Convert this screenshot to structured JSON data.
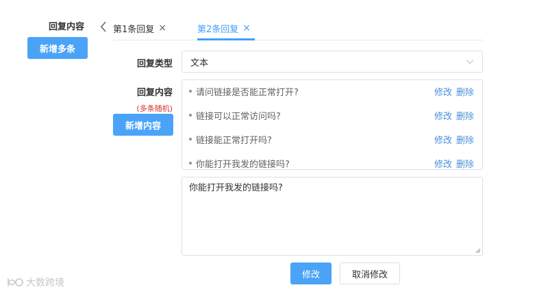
{
  "left_panel": {
    "section_label": "回复内容",
    "add_multi_button": "新增多条"
  },
  "tabs": {
    "items": [
      {
        "label": "第1条回复",
        "active": false
      },
      {
        "label": "第2条回复",
        "active": true
      }
    ]
  },
  "form": {
    "type_label": "回复类型",
    "type_value": "文本",
    "content_label": "回复内容",
    "content_note": "(多条随机)",
    "add_content_button": "新增内容",
    "items": [
      {
        "text": "请问链接是否能正常打开?",
        "edit": "修改",
        "delete": "删除"
      },
      {
        "text": "链接可以正常访问吗?",
        "edit": "修改",
        "delete": "删除"
      },
      {
        "text": "链接能正常打开吗?",
        "edit": "修改",
        "delete": "删除"
      },
      {
        "text": "你能打开我发的链接吗?",
        "edit": "修改",
        "delete": "删除"
      }
    ],
    "editor_value": "你能打开我发的链接吗?",
    "save_button": "修改",
    "cancel_button": "取消修改"
  },
  "watermark": {
    "text": "大数跨境"
  },
  "colors": {
    "primary": "#4aa3f7",
    "tab_active": "#409eff",
    "link": "#4a8fd6",
    "note": "#d93025",
    "border": "#dcdfe6"
  }
}
